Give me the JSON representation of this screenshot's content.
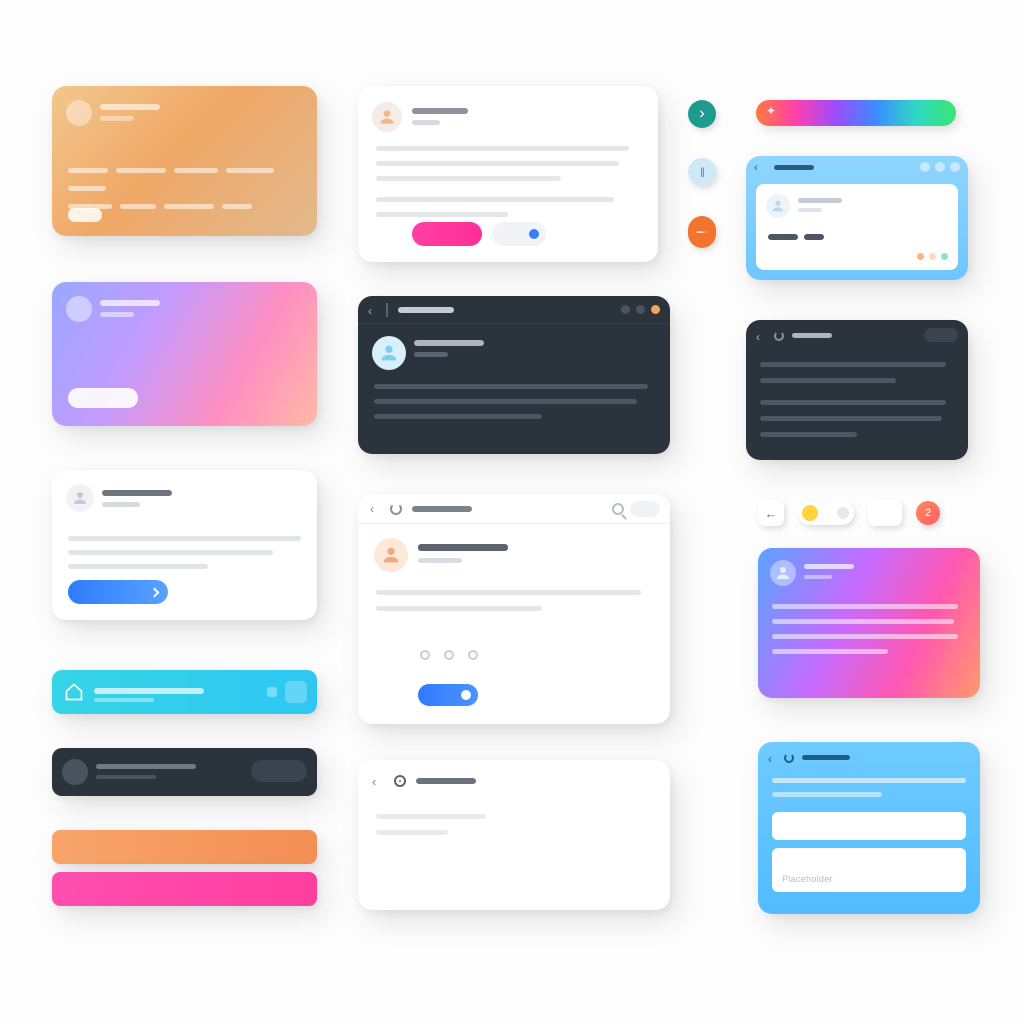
{
  "colors": {
    "dark_card": "#2b333d",
    "blue_btn": "#2f7bff",
    "pink_btn": "#ff3fa4",
    "cyan_bar": "#2dc7f2",
    "orange_slab": "#f38f55",
    "pink_slab": "#ff3e9d"
  },
  "icons": {
    "chevron_right": "›",
    "chevron_left": "‹",
    "pause": "⏸",
    "info": "i",
    "home": "⌂",
    "sparkle": "✦"
  },
  "circle_buttons": {
    "play": "›",
    "pause": "||",
    "info": "i"
  },
  "mini_browser": {
    "dot_colors": [
      "#ffb37a",
      "#ffd9b5",
      "#8fe0c9"
    ]
  },
  "dark_window": {
    "dot_colors": [
      "#4a5460",
      "#4a5460",
      "#f2a65a"
    ]
  },
  "control_row": {
    "back": "←",
    "badge_count": "2"
  },
  "form_card": {
    "placeholder": "Placeholder"
  }
}
